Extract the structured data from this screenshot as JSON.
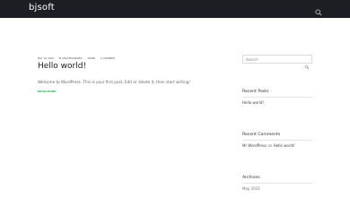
{
  "header": {
    "brand": "bjsoft",
    "search_icon": "search-icon"
  },
  "post": {
    "meta": [
      "May 10, 2016",
      "In Uncategorized",
      "admin",
      "1 Comment"
    ],
    "title": "Hello world!",
    "excerpt": "Welcome to WordPress. This is your first post. Edit or delete it, then start writing!",
    "read_more": "Read more"
  },
  "sidebar": {
    "search_placeholder": "Search",
    "recent_posts": {
      "title": "Recent Posts",
      "items": [
        "Hello world!"
      ]
    },
    "recent_comments": {
      "title": "Recent Comments",
      "author": "Mr WordPress",
      "on": "on",
      "post": "Hello world!"
    },
    "archives": {
      "title": "Archives",
      "items": [
        "May 2016"
      ]
    }
  },
  "colors": {
    "topbar": "#1c1e24",
    "accent_green": "#21b157"
  }
}
